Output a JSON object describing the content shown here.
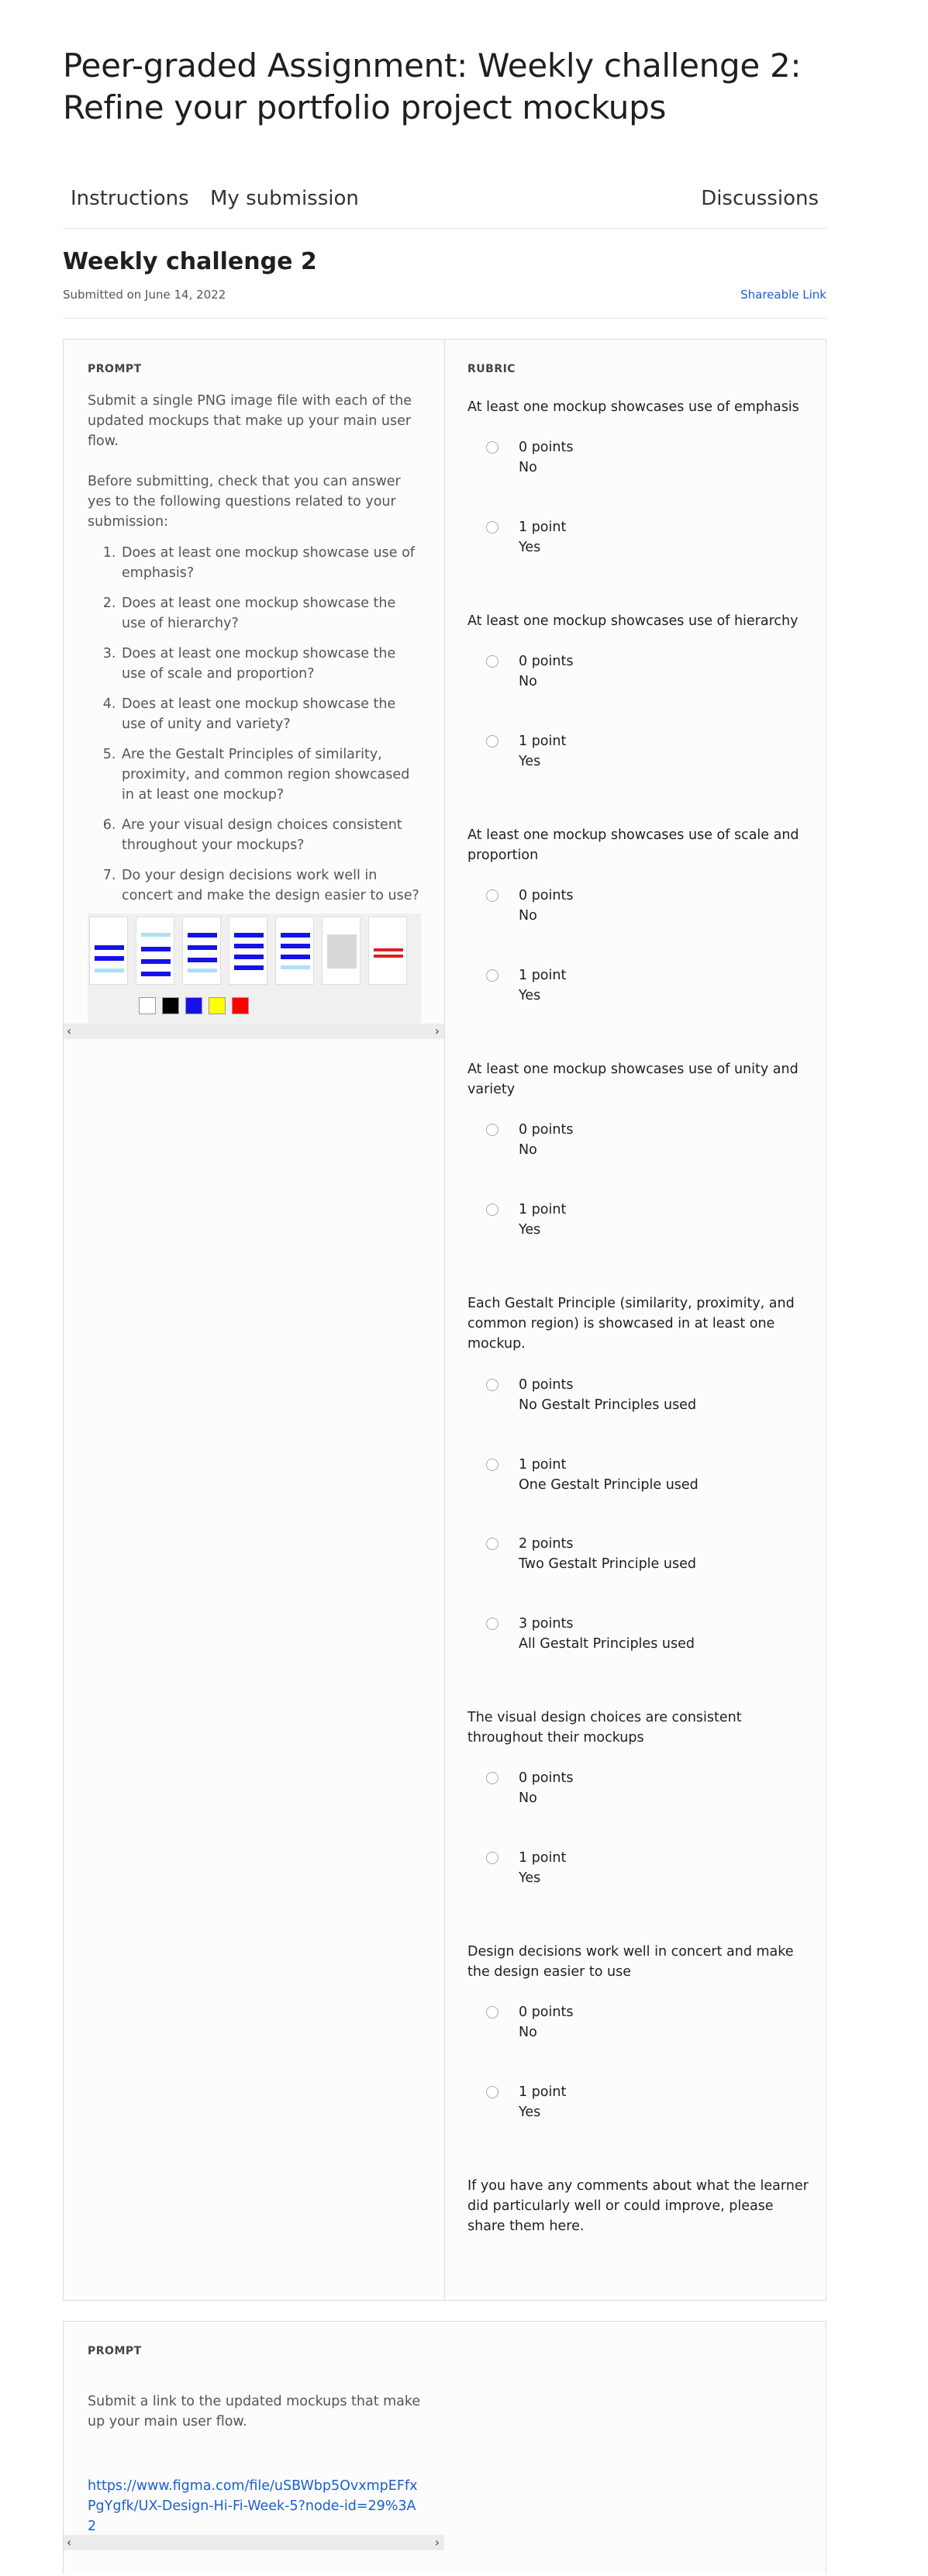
{
  "page": {
    "title": "Peer-graded Assignment: Weekly challenge 2: Refine your portfolio project mockups"
  },
  "tabs": [
    {
      "label": "Instructions"
    },
    {
      "label": "My submission"
    },
    {
      "label": "Discussions"
    }
  ],
  "submission": {
    "title": "Weekly challenge 2",
    "submitted": "Submitted on June 14, 2022",
    "shareable_link": "Shareable Link"
  },
  "prompt1": {
    "label": "PROMPT",
    "text": "Submit a single PNG image file with each of the updated mockups that make up your main user flow.",
    "text2": "Before submitting, check that you can answer yes to the following questions related to your submission:",
    "questions": [
      "Does at least one mockup showcase use of emphasis?",
      "Does at least one mockup showcase the use of hierarchy?",
      "Does at least one mockup showcase the use of scale and proportion?",
      "Does at least one mockup showcase the use of unity and variety?",
      "Are the Gestalt Principles of similarity, proximity, and common region showcased in at least one mockup?",
      "Are your visual design choices consistent throughout your mockups?",
      "Do your design decisions work well in concert and make the design easier to use?"
    ],
    "image_alt": "mockups-image",
    "scroll_left": "‹",
    "scroll_right": "›"
  },
  "rubric": {
    "label": "RUBRIC",
    "criteria": [
      {
        "title": "At least one mockup showcases use of emphasis",
        "options": [
          {
            "points": "0 points",
            "desc": "No"
          },
          {
            "points": "1 point",
            "desc": "Yes"
          }
        ]
      },
      {
        "title": "At least one mockup showcases use of hierarchy",
        "options": [
          {
            "points": "0 points",
            "desc": "No"
          },
          {
            "points": "1 point",
            "desc": "Yes"
          }
        ]
      },
      {
        "title": "At least one mockup showcases use of scale and proportion",
        "options": [
          {
            "points": "0 points",
            "desc": "No"
          },
          {
            "points": "1 point",
            "desc": "Yes"
          }
        ]
      },
      {
        "title": "At least one mockup showcases use of unity and variety",
        "options": [
          {
            "points": "0 points",
            "desc": "No"
          },
          {
            "points": "1 point",
            "desc": "Yes"
          }
        ]
      },
      {
        "title": "Each Gestalt Principle (similarity, proximity, and common region) is showcased in at least one mockup.",
        "options": [
          {
            "points": "0 points",
            "desc": "No Gestalt Principles used"
          },
          {
            "points": "1 point",
            "desc": "One Gestalt Principle used"
          },
          {
            "points": "2 points",
            "desc": "Two Gestalt Principle used"
          },
          {
            "points": "3 points",
            "desc": "All Gestalt Principles used"
          }
        ]
      },
      {
        "title": "The visual design choices are consistent throughout their mockups",
        "options": [
          {
            "points": "0 points",
            "desc": "No"
          },
          {
            "points": "1 point",
            "desc": "Yes"
          }
        ]
      },
      {
        "title": "Design decisions work well in concert and make the design easier to use",
        "options": [
          {
            "points": "0 points",
            "desc": "No"
          },
          {
            "points": "1 point",
            "desc": "Yes"
          }
        ]
      }
    ],
    "comments": "If you have any comments about what the learner did particularly well or could improve, please share them here."
  },
  "prompt2": {
    "label": "PROMPT",
    "text": "Submit a link to the updated mockups that make up your main user flow.",
    "link": "https://www.figma.com/file/uSBWbp5OvxmpEFfxPgYgfk/UX-Design-Hi-Fi-Week-5?node-id=29%3A2",
    "scroll_left": "‹",
    "scroll_right": "›"
  },
  "colors": {
    "link": "#1a5fd0",
    "mockup_blue": "#1511e8",
    "palette": [
      "#ffffff",
      "#000000",
      "#1511e8",
      "#ffff00",
      "#ff0000"
    ]
  }
}
